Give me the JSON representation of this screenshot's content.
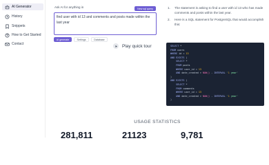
{
  "sidebar": {
    "items": [
      {
        "label": "AI Generator",
        "icon": "robot-icon",
        "active": true
      },
      {
        "label": "History",
        "icon": "clock-icon",
        "active": false
      },
      {
        "label": "Snippets",
        "icon": "bookmark-icon",
        "active": false
      },
      {
        "label": "How to Get Started",
        "icon": "question-icon",
        "active": false
      },
      {
        "label": "Contact",
        "icon": "mail-icon",
        "active": false
      }
    ]
  },
  "query": {
    "label": "Ask AI for anything in",
    "new_chat_label": "New sql query",
    "value": "find user with id 13 and comments and posts made within the last year"
  },
  "modes": {
    "generate": "AI generate",
    "settings": "Settings",
    "database": "Database"
  },
  "tour": {
    "label": "Play quick tour"
  },
  "answer": {
    "items": [
      {
        "num": "1.",
        "text": "The statement is asking to find a user with id 13 who has made comments and posts within the last year."
      },
      {
        "num": "2.",
        "text": "Here is a SQL statement for PostgreSQL that would accomplish this:"
      }
    ]
  },
  "code_lines": [
    "SELECT *",
    "FROM users",
    "WHERE id = 13",
    "AND EXISTS (",
    "    SELECT *",
    "    FROM posts",
    "    WHERE user_id = 13",
    "    AND date_created > NOW() - INTERVAL '1 year'",
    ")",
    "AND EXISTS (",
    "    SELECT *",
    "    FROM comments",
    "    WHERE user_id = 13",
    "    AND date_created > NOW() - INTERVAL '1 year'",
    ")"
  ],
  "stats": {
    "title": "USAGE STATISTICS",
    "values": [
      "281,811",
      "21123",
      "9,781"
    ]
  },
  "colors": {
    "accent": "#6d5dd3",
    "code_bg": "#1b2333"
  }
}
